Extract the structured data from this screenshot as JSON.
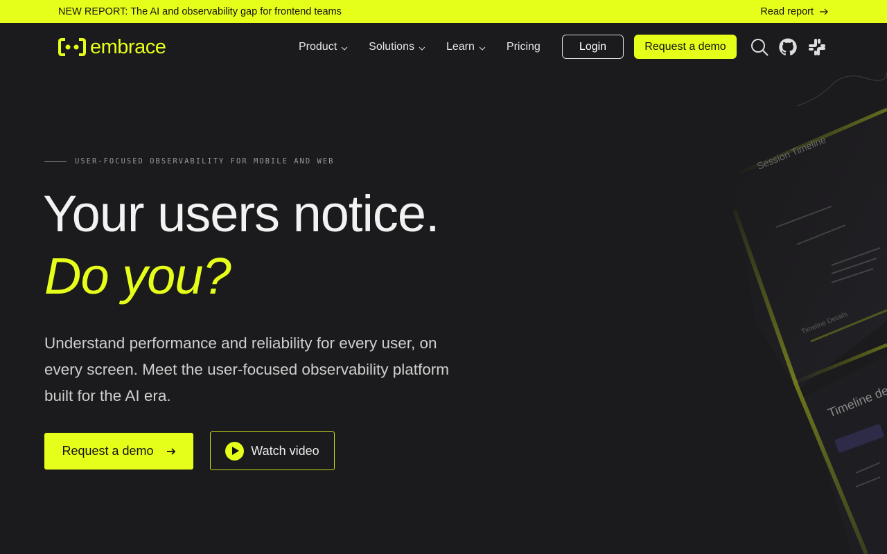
{
  "banner": {
    "text": "NEW REPORT: The AI and observability gap for frontend teams",
    "link": "Read report"
  },
  "nav": {
    "logo_text": "embrace",
    "items": [
      {
        "label": "Product",
        "has_dropdown": true
      },
      {
        "label": "Solutions",
        "has_dropdown": true
      },
      {
        "label": "Learn",
        "has_dropdown": true
      },
      {
        "label": "Pricing",
        "has_dropdown": false
      }
    ],
    "login": "Login",
    "demo": "Request a demo",
    "icons": [
      "search-icon",
      "github-icon",
      "slack-icon"
    ]
  },
  "hero": {
    "eyebrow": "USER-FOCUSED OBSERVABILITY FOR MOBILE AND WEB",
    "headline": "Your users notice.",
    "headline_accent": "Do you?",
    "subtext": "Understand performance and reliability for every user, on every screen. Meet the user-focused observability platform built for the AI era.",
    "cta_primary": "Request a demo",
    "cta_secondary": "Watch video"
  },
  "visual": {
    "labels": [
      "Session Timeline",
      "Timeline Details",
      "Timeline de"
    ]
  },
  "colors": {
    "accent": "#e6ff1a",
    "background": "#1b1a1c",
    "text": "#ffffff"
  }
}
